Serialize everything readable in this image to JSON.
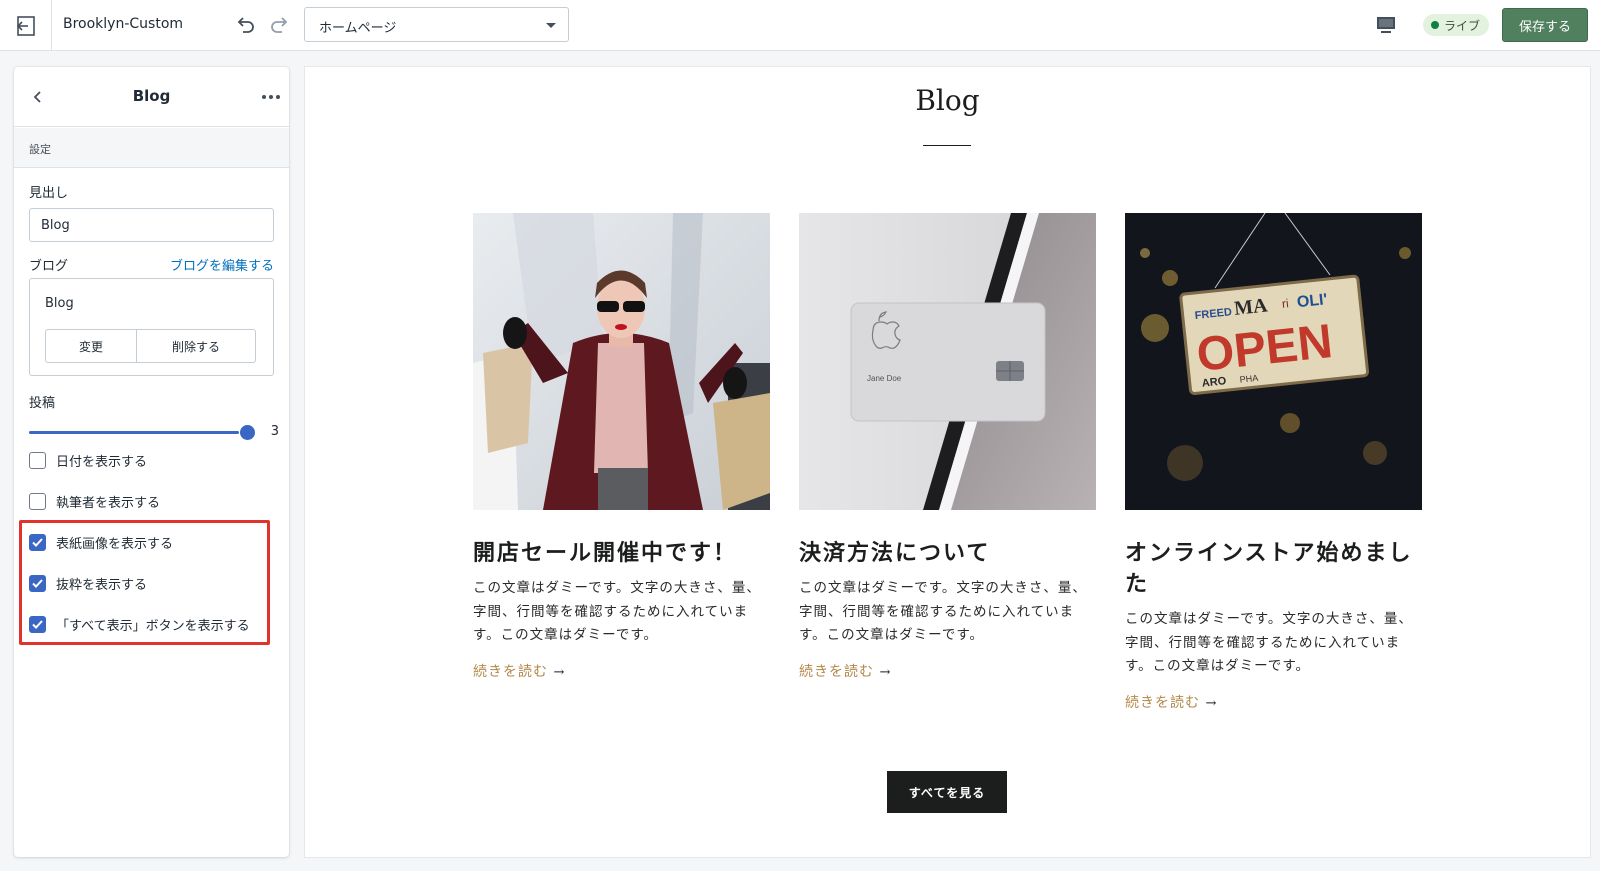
{
  "topbar": {
    "theme_name": "Brooklyn-Custom",
    "page_select_value": "ホームページ",
    "status_label": "ライブ",
    "save_label": "保存する"
  },
  "sidebar": {
    "title": "Blog",
    "section_label": "設定",
    "heading_label": "見出し",
    "heading_value": "Blog",
    "blog_label": "ブログ",
    "edit_blog_link": "ブログを編集する",
    "blog_name": "Blog",
    "change_label": "変更",
    "delete_label": "削除する",
    "posts_label": "投稿",
    "posts_value": "3",
    "posts_fraction": 1.0,
    "checkboxes": [
      {
        "label": "日付を表示する",
        "checked": false
      },
      {
        "label": "執筆者を表示する",
        "checked": false
      },
      {
        "label": "表紙画像を表示する",
        "checked": true
      },
      {
        "label": "抜粋を表示する",
        "checked": true
      },
      {
        "label": "「すべて表示」ボタンを表示する",
        "checked": true
      }
    ]
  },
  "preview": {
    "title": "Blog",
    "posts": [
      {
        "title": "開店セール開催中です！",
        "excerpt": "この文章はダミーです。文字の大きさ、量、字間、行間等を確認するために入れています。この文章はダミーです。",
        "read_more": "続きを読む"
      },
      {
        "title": "決済方法について",
        "excerpt": "この文章はダミーです。文字の大きさ、量、字間、行間等を確認するために入れています。この文章はダミーです。",
        "read_more": "続きを読む",
        "card_name": "Jane Doe"
      },
      {
        "title": "オンラインストア始めました",
        "excerpt": "この文章はダミーです。文字の大きさ、量、字間、行間等を確認するために入れています。この文章はダミーです。",
        "read_more": "続きを読む",
        "sign_text": "OPEN"
      }
    ],
    "view_all_label": "すべてを見る"
  },
  "colors": {
    "accent_blue": "#3a66c4",
    "save_green": "#50805e",
    "live_green": "#108043",
    "highlight_red": "#e0332b",
    "link_gold": "#b3884a"
  },
  "icons": [
    "exit-icon",
    "undo-icon",
    "redo-icon",
    "chevron-down-icon",
    "desktop-icon",
    "back-chevron-icon",
    "more-horizontal-icon",
    "checkmark-icon",
    "arrow-right-icon"
  ]
}
